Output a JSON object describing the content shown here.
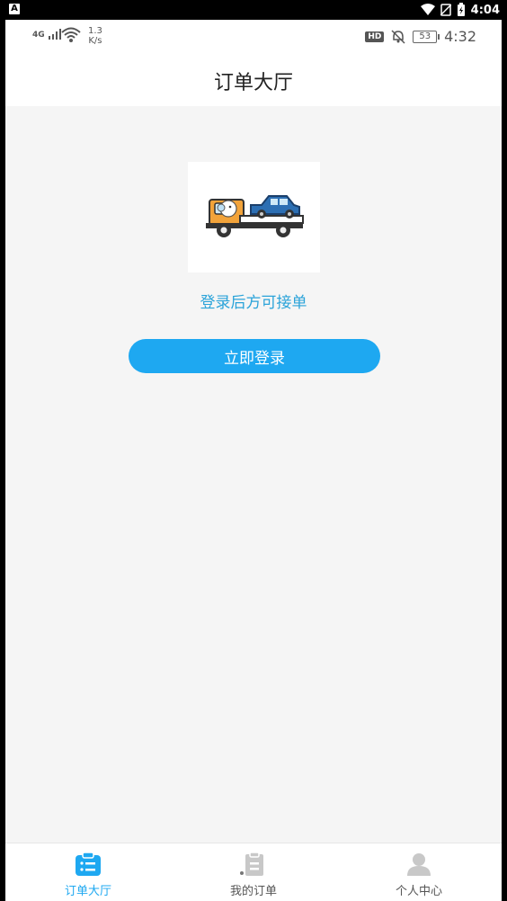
{
  "system_bar": {
    "left_badge": "A",
    "time": "4:04"
  },
  "phone_status": {
    "network": "4G",
    "speed_value": "1.3",
    "speed_unit": "K/s",
    "hd_badge": "HD",
    "battery": "53",
    "time": "4:32"
  },
  "header": {
    "title": "订单大厅"
  },
  "main": {
    "hint": "登录后方可接单",
    "login_button": "立即登录"
  },
  "tabs": [
    {
      "label": "订单大厅",
      "icon": "order-hall-icon",
      "active": true
    },
    {
      "label": "我的订单",
      "icon": "my-orders-icon",
      "active": false
    },
    {
      "label": "个人中心",
      "icon": "profile-icon",
      "active": false
    }
  ],
  "colors": {
    "accent": "#1ea8f1",
    "hint": "#2aa3d9",
    "background": "#f5f5f5"
  }
}
